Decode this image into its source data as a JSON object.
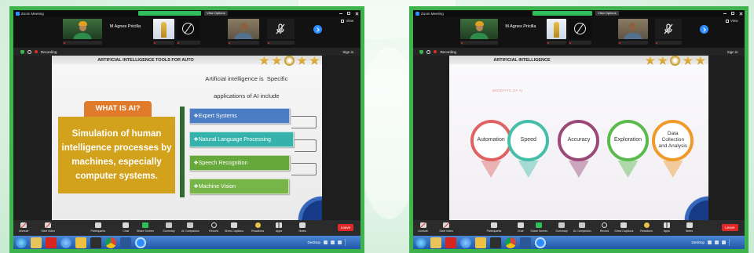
{
  "window": {
    "title": "Zoom Meeting",
    "view_options": "View Options",
    "view": "View",
    "recording": "Recording",
    "sign_in": "Sign in",
    "participant_name": "M Agnes Pricilla"
  },
  "toolbar": {
    "items": [
      {
        "label": "Unmute",
        "icon": "mic-off-icon"
      },
      {
        "label": "Start Video",
        "icon": "video-off-icon"
      },
      {
        "label": "Participants",
        "icon": "participants-icon"
      },
      {
        "label": "Chat",
        "icon": "chat-icon"
      },
      {
        "label": "Share Screen",
        "icon": "share-screen-icon"
      },
      {
        "label": "Summary",
        "icon": "summary-icon"
      },
      {
        "label": "AI Companion",
        "icon": "ai-companion-icon"
      },
      {
        "label": "Record",
        "icon": "record-icon"
      },
      {
        "label": "Show Captions",
        "icon": "captions-icon"
      },
      {
        "label": "Reactions",
        "icon": "reactions-icon"
      },
      {
        "label": "Apps",
        "icon": "apps-icon"
      },
      {
        "label": "Notes",
        "icon": "notes-icon"
      }
    ],
    "leave": "Leave"
  },
  "taskbar": {
    "icons": [
      "start-orb-icon",
      "file-explorer-icon",
      "pdf-icon",
      "internet-explorer-icon",
      "folder-icon",
      "media-player-icon",
      "chrome-icon",
      "word-icon",
      "zoom-icon"
    ],
    "desktop": "Desktop"
  },
  "slides": [
    {
      "title": "ARTIFICIAL INTELLIGENCE TOOLS FOR AUTO",
      "intro_line1": "Artificial intelligence is  Specific",
      "intro_line2": "applications of AI include",
      "heading": "WHAT IS AI?",
      "heading_color": "#e07b2c",
      "definition": "Simulation of human intelligence processes by machines, especially computer systems.",
      "definition_color": "#d3a21d",
      "applications": [
        {
          "label": "❖Expert Systems",
          "color": "#4b7dc2"
        },
        {
          "label": "❖Natural Language Processing",
          "color": "#35b2ab"
        },
        {
          "label": "❖Speech Recognition",
          "color": "#66a83a"
        },
        {
          "label": "❖Machine Vision",
          "color": "#78b548"
        }
      ]
    },
    {
      "title": "ARTIFICIAL INTELLIGENCE",
      "subtitle": "BENEFITS OF AI",
      "benefits": [
        {
          "label": "Automation",
          "color": "#e06363"
        },
        {
          "label": "Speed",
          "color": "#45bfa8"
        },
        {
          "label": "Accuracy",
          "color": "#9b4a78"
        },
        {
          "label": "Exploration",
          "color": "#5bbb4c"
        },
        {
          "label": "Data Collection and Analysis",
          "color": "#f09a2c"
        }
      ]
    }
  ],
  "colors": {
    "frame": "#3cb44b",
    "share_banner": "#2fbf5a",
    "leave": "#e02828",
    "zoom_accent": "#2d8cff"
  }
}
